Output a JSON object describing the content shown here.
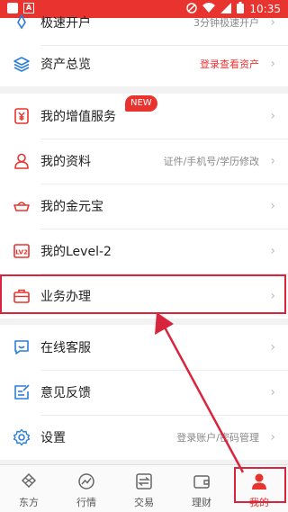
{
  "status_bar": {
    "time": "10:35"
  },
  "menu": {
    "partial_item": {
      "label": "极速开户",
      "sub": "3分钟极速开户"
    },
    "asset": {
      "label": "资产总览",
      "sub": "登录查看资产"
    },
    "vip": {
      "label": "我的增值服务",
      "badge": "NEW"
    },
    "profile": {
      "label": "我的资料",
      "sub": "证件/手机号/学历修改"
    },
    "gold": {
      "label": "我的金元宝"
    },
    "level2": {
      "label": "我的Level-2",
      "icon_text": "LV2"
    },
    "business": {
      "label": "业务办理"
    },
    "service": {
      "label": "在线客服"
    },
    "feedback": {
      "label": "意见反馈"
    },
    "settings": {
      "label": "设置",
      "sub": "登录账户/密码管理"
    },
    "chevron": "›"
  },
  "tabs": [
    {
      "label": "东方",
      "icon": "dongfang-logo-icon"
    },
    {
      "label": "行情",
      "icon": "chart-icon"
    },
    {
      "label": "交易",
      "icon": "exchange-icon"
    },
    {
      "label": "理财",
      "icon": "wallet-icon"
    },
    {
      "label": "我的",
      "icon": "person-icon",
      "active": true
    }
  ],
  "colors": {
    "accent": "#e8332e",
    "annotation": "#d8243c",
    "icon_blue": "#2d7ed7"
  }
}
